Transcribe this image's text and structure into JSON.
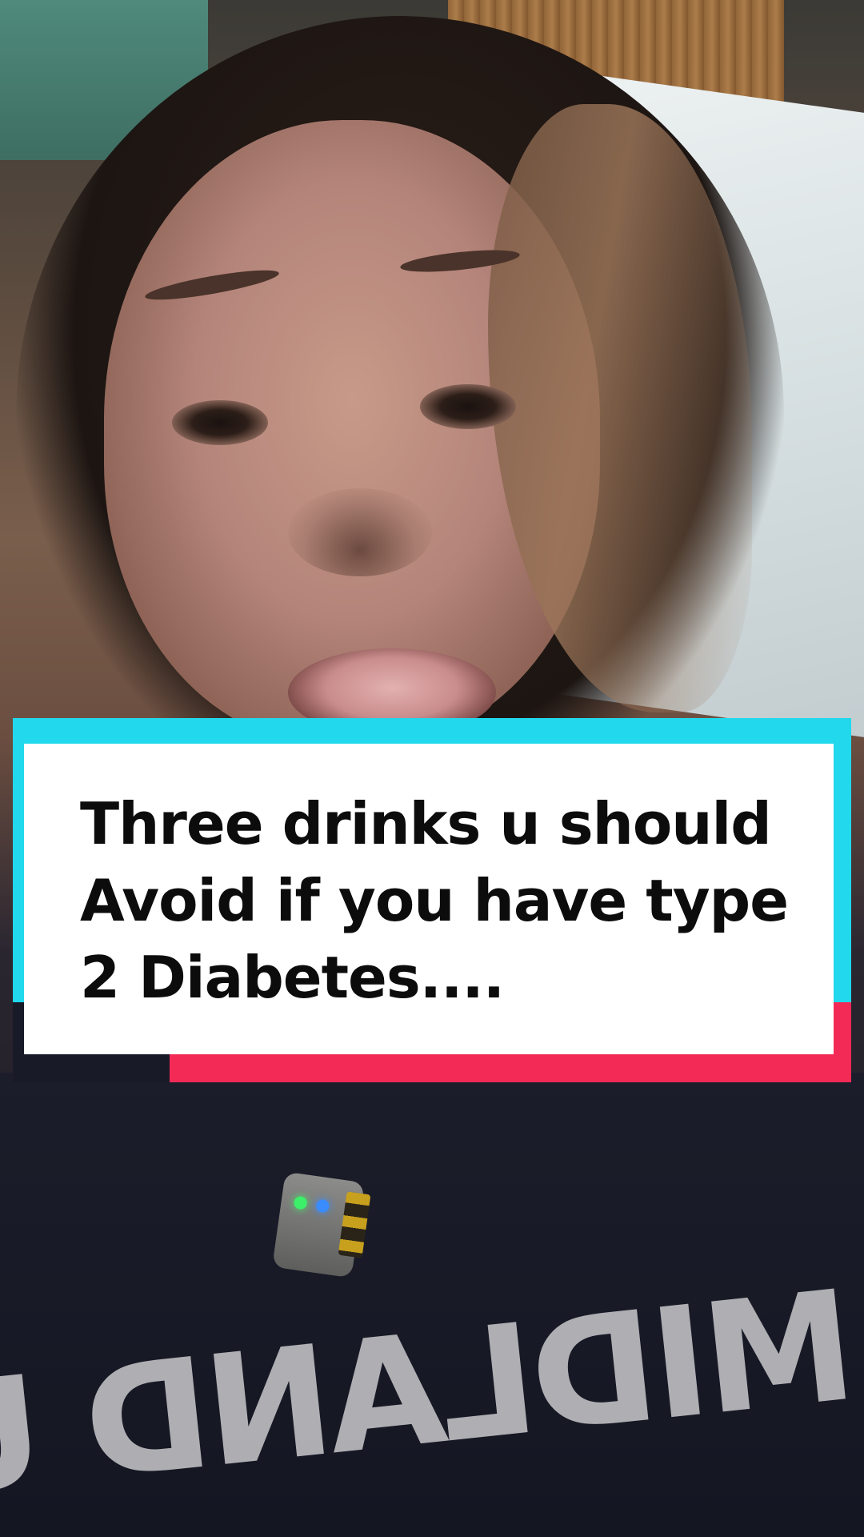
{
  "caption": {
    "text": "Three drinks u should Avoid if you have type 2 Diabetes...."
  },
  "scene": {
    "shirt_text": "MIDLAND UNIVERSITY"
  },
  "colors": {
    "caption_cyan": "#21d8ec",
    "caption_red": "#f32a56",
    "caption_dark": "#181a28",
    "caption_card": "#ffffff",
    "caption_text": "#0c0c0c"
  }
}
